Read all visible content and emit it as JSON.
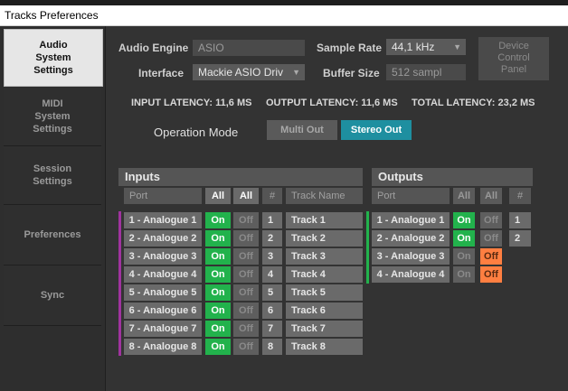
{
  "window": {
    "title": "Tracks Preferences"
  },
  "sidebar": {
    "items": [
      {
        "label": "Audio\nSystem\nSettings",
        "active": true
      },
      {
        "label": "MIDI\nSystem\nSettings",
        "active": false
      },
      {
        "label": "Session\nSettings",
        "active": false
      },
      {
        "label": "Preferences",
        "active": false
      },
      {
        "label": "Sync",
        "active": false
      }
    ]
  },
  "settings": {
    "audio_engine_label": "Audio Engine",
    "audio_engine_value": "ASIO",
    "interface_label": "Interface",
    "interface_value": "Mackie ASIO Driv",
    "sample_rate_label": "Sample Rate",
    "sample_rate_value": "44,1 kHz",
    "buffer_size_label": "Buffer Size",
    "buffer_size_value": "512 sampl",
    "device_control_panel": "Device\nControl\nPanel"
  },
  "latency": {
    "input": "INPUT LATENCY: 11,6 MS",
    "output": "OUTPUT LATENCY: 11,6 MS",
    "total": "TOTAL LATENCY: 23,2 MS"
  },
  "operation_mode": {
    "label": "Operation Mode",
    "options": [
      "Multi Out",
      "Stereo Out"
    ],
    "selected": "Stereo Out"
  },
  "inputs": {
    "title": "Inputs",
    "headers": {
      "port": "Port",
      "all1": "All",
      "all2": "All",
      "num": "#",
      "track": "Track Name"
    },
    "rows": [
      {
        "port": "1 - Analogue 1",
        "on": "On",
        "off": "Off",
        "num": "1",
        "track": "Track 1"
      },
      {
        "port": "2 - Analogue 2",
        "on": "On",
        "off": "Off",
        "num": "2",
        "track": "Track 2"
      },
      {
        "port": "3 - Analogue 3",
        "on": "On",
        "off": "Off",
        "num": "3",
        "track": "Track 3"
      },
      {
        "port": "4 - Analogue 4",
        "on": "On",
        "off": "Off",
        "num": "4",
        "track": "Track 4"
      },
      {
        "port": "5 - Analogue 5",
        "on": "On",
        "off": "Off",
        "num": "5",
        "track": "Track 5"
      },
      {
        "port": "6 - Analogue 6",
        "on": "On",
        "off": "Off",
        "num": "6",
        "track": "Track 6"
      },
      {
        "port": "7 - Analogue 7",
        "on": "On",
        "off": "Off",
        "num": "7",
        "track": "Track 7"
      },
      {
        "port": "8 - Analogue 8",
        "on": "On",
        "off": "Off",
        "num": "8",
        "track": "Track 8"
      }
    ]
  },
  "outputs": {
    "title": "Outputs",
    "headers": {
      "port": "Port",
      "all1": "All",
      "all2": "All",
      "num": "#"
    },
    "rows": [
      {
        "port": "1 - Analogue 1",
        "on": "On",
        "off": "Off",
        "num": "1",
        "state": "on"
      },
      {
        "port": "2 - Analogue 2",
        "on": "On",
        "off": "Off",
        "num": "2",
        "state": "on"
      },
      {
        "port": "3 - Analogue 3",
        "on": "On",
        "off": "Off",
        "num": "",
        "state": "off"
      },
      {
        "port": "4 - Analogue 4",
        "on": "On",
        "off": "Off",
        "num": "",
        "state": "off"
      }
    ]
  },
  "colors": {
    "accent": "#1e8fa0",
    "on_green": "#22b24c",
    "off_orange": "#ff7f41",
    "input_bar": "#a0339f",
    "output_bar": "#22b24c"
  }
}
